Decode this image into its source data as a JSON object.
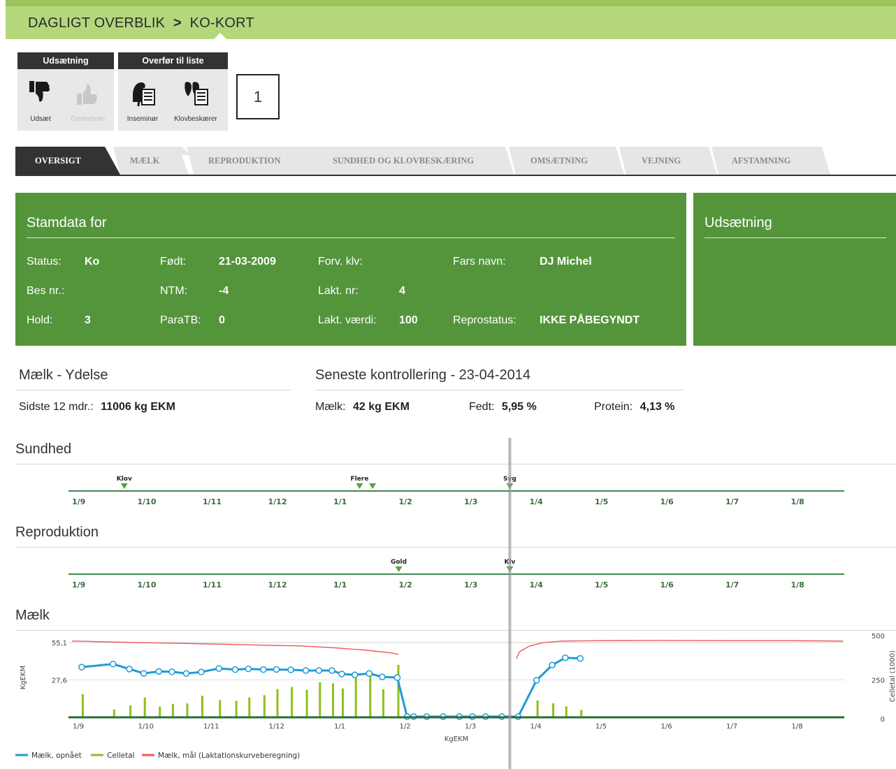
{
  "breadcrumb": {
    "root": "DAGLIGT OVERBLIK",
    "separator": ">",
    "current": "KO-KORT"
  },
  "toolbar": {
    "group1": {
      "title": "Udsætning",
      "buttons": [
        {
          "label": "Udsæt",
          "icon": "thumbs-down-icon",
          "enabled": true
        },
        {
          "label": "Genindsæt",
          "icon": "thumbs-up-icon",
          "enabled": false
        }
      ]
    },
    "group2": {
      "title": "Overfør til liste",
      "buttons": [
        {
          "label": "Inseminør",
          "icon": "inseminator-icon",
          "enabled": true
        },
        {
          "label": "Klovbeskærer",
          "icon": "hoof-trimmer-icon",
          "enabled": true
        }
      ]
    }
  },
  "annotation_label": "1",
  "tabs": [
    {
      "label": "OVERSIGT",
      "active": true
    },
    {
      "label": "MÆLK"
    },
    {
      "label": "REPRODUKTION"
    },
    {
      "label": "SUNDHED OG KLOVBESKÆRING"
    },
    {
      "label": "OMSÆTNING"
    },
    {
      "label": "VEJNING"
    },
    {
      "label": "AFSTAMNING"
    }
  ],
  "stamdata": {
    "title": "Stamdata for",
    "status_label": "Status:",
    "status_value": "Ko",
    "born_label": "Født:",
    "born_value": "21-03-2009",
    "forv_label": "Forv. klv:",
    "forv_value": "",
    "father_label": "Fars navn:",
    "father_value": "DJ Michel",
    "bes_label": "Bes nr.:",
    "bes_value": "",
    "ntm_label": "NTM:",
    "ntm_value": "-4",
    "lakt_nr_label": "Lakt. nr:",
    "lakt_nr_value": "4",
    "hold_label": "Hold:",
    "hold_value": "3",
    "paratb_label": "ParaTB:",
    "paratb_value": "0",
    "lakt_val_label": "Lakt. værdi:",
    "lakt_val_value": "100",
    "repro_label": "Reprostatus:",
    "repro_value": "IKKE PÅBEGYNDT"
  },
  "udsaetning_panel": {
    "title": "Udsætning"
  },
  "milk_yield": {
    "title": "Mælk - Ydelse",
    "label": "Sidste 12 mdr.:",
    "value": "11006 kg EKM"
  },
  "latest_control": {
    "title": "Seneste kontrollering - 23-04-2014",
    "milk_label": "Mælk:",
    "milk_value": "42 kg EKM",
    "fat_label": "Fedt:",
    "fat_value": "5,95 %",
    "protein_label": "Protein:",
    "protein_value": "4,13 %"
  },
  "timeline_months": [
    "1/9",
    "1/10",
    "1/11",
    "1/12",
    "1/1",
    "1/2",
    "1/3",
    "1/4",
    "1/5",
    "1/6",
    "1/7",
    "1/8"
  ],
  "sundhed": {
    "title": "Sundhed",
    "events": [
      {
        "label": "Klov",
        "month": 0.8
      },
      {
        "label": "Flere",
        "month": 4.4
      },
      {
        "label": "Syg",
        "month": 6.7
      }
    ],
    "extra_markers": [
      4.6
    ]
  },
  "reproduktion": {
    "title": "Reproduktion",
    "events": [
      {
        "label": "Gold",
        "month": 5.0
      },
      {
        "label": "Klv",
        "month": 6.7
      }
    ]
  },
  "colors": {
    "green_header": "#b5d77c",
    "panel_green": "#54953c",
    "timeline_green": "#3f8a4f",
    "milk_blue": "#1f9ad6",
    "cell_green": "#8bc21a",
    "target_red": "#f05a5a"
  },
  "chart_data": {
    "type": "line",
    "title": "Mælk",
    "xlabel": "KgEKM",
    "ylabel": "KgEKM",
    "y2label": "Celletal (1000)",
    "x_ticks": [
      "1/9",
      "1/10",
      "1/11",
      "1/12",
      "1/1",
      "1/2",
      "1/3",
      "1/4",
      "1/5",
      "1/6",
      "1/7",
      "1/8"
    ],
    "y_ticks": [
      "55,1",
      "27,6"
    ],
    "y2_ticks": [
      "500",
      "250",
      "0"
    ],
    "ylim": [
      0,
      55.1
    ],
    "y2lim": [
      0,
      500
    ],
    "current_month_marker": 6.7,
    "legend_position": "bottom-left",
    "series": [
      {
        "name": "Mælk, opnået",
        "type": "line",
        "x": [
          0.02,
          0.5,
          0.75,
          0.97,
          1.2,
          1.4,
          1.62,
          1.85,
          2.12,
          2.37,
          2.57,
          2.8,
          3.0,
          3.22,
          3.45,
          3.65,
          3.85,
          4.0,
          4.2,
          4.42,
          4.62,
          4.85,
          5.0,
          5.1,
          5.3,
          5.55,
          5.8,
          6.0,
          6.2,
          6.45,
          6.7,
          6.98,
          7.22,
          7.42,
          7.65
        ],
        "y": [
          37.0,
          39.3,
          35.6,
          32.4,
          33.8,
          33.6,
          32.3,
          33.4,
          36.0,
          35.2,
          35.7,
          35.2,
          35.3,
          35.0,
          34.5,
          34.5,
          34.5,
          32.0,
          31.3,
          32.3,
          29.8,
          29.3,
          0.5,
          0.5,
          0.5,
          0.5,
          0.5,
          0.5,
          0.5,
          0.5,
          0.5,
          27.3,
          38.5,
          43.9,
          43.4
        ]
      },
      {
        "name": "Celletal",
        "type": "bar",
        "x": [
          0.02,
          0.5,
          0.75,
          0.97,
          1.2,
          1.4,
          1.62,
          1.85,
          2.12,
          2.37,
          2.57,
          2.8,
          3.0,
          3.22,
          3.45,
          3.65,
          3.85,
          4.0,
          4.2,
          4.42,
          4.62,
          4.85,
          5.0,
          6.98,
          7.22,
          7.42,
          7.65
        ],
        "y": [
          154,
          52,
          80,
          132,
          72,
          90,
          93,
          144,
          115,
          111,
          132,
          148,
          189,
          203,
          184,
          235,
          227,
          193,
          268,
          279,
          188,
          351,
          0,
          113,
          94,
          73,
          50
        ]
      },
      {
        "name": "Mælk, mål (Laktationskurveberegning)",
        "type": "line",
        "segments": [
          {
            "x": [
              0.0,
              1.0,
              2.0,
              3.0,
              3.5,
              4.0,
              4.5,
              4.9,
              5.0
            ],
            "y": [
              56.3,
              55.1,
              54.2,
              53.1,
              52.6,
              51.3,
              49.5,
              47.4,
              46.4
            ]
          },
          {
            "x": [
              6.8,
              6.85,
              7.0,
              7.2,
              7.5,
              8.0,
              9.0,
              10.0,
              11.0,
              11.8
            ],
            "y": [
              43.3,
              48.4,
              52.5,
              55.0,
              56.2,
              56.5,
              56.7,
              56.5,
              56.5,
              56.2
            ]
          }
        ]
      }
    ]
  }
}
